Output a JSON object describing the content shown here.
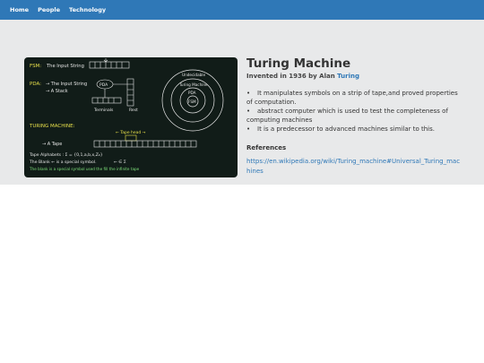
{
  "nav": {
    "items": [
      "Home",
      "People",
      "Technology"
    ]
  },
  "diagram": {
    "fsm_label": "FSM:",
    "fsm_text": "The Input String",
    "pda_label": "PDA:",
    "pda_line1": "→ The Input String",
    "pda_line2": "→ A Stack",
    "pda_box": "PDA",
    "terminals": "Terminals",
    "rest": "Rest",
    "tm_label": "TURING MACHINE:",
    "tape_head": "← Tape head →",
    "a_tape": "→ A Tape",
    "alphabets": "Tape Alphabets :  Σ = {0,1,a,b,x,Z₀}",
    "blank1": "The Blank ← is a special symbol.",
    "blank_sym": "← ∈ Σ",
    "blank2": "The blank is a special symbol used the fill the infinite tape",
    "undecidable": "Undecidable",
    "turing_machine": "Turing Machine",
    "pda_circle": "PDA",
    "fsm_circle": "FSM"
  },
  "article": {
    "title": "Turing Machine",
    "invented_prefix": "Invented in 1936 by Alan ",
    "inventor_link": "Turing",
    "points": [
      "It manipulates symbols on a strip of tape,and proved properties of computation.",
      "abstract computer which is used to test the completeness of computing machines",
      "It is a predecessor to advanced machines similar to this."
    ],
    "references_heading": "References",
    "reference_url": "https://en.wikipedia.org/wiki/Turing_machine#Universal_Turing_machines"
  },
  "colors": {
    "navbar": "#2f78b7",
    "link": "#2f78b7",
    "section_bg": "#e8e9ea",
    "diagram_bg": "#111c18",
    "chalk_yellow": "#e8e04a",
    "chalk_white": "#e6e6e6",
    "chalk_green": "#7ee07a"
  }
}
